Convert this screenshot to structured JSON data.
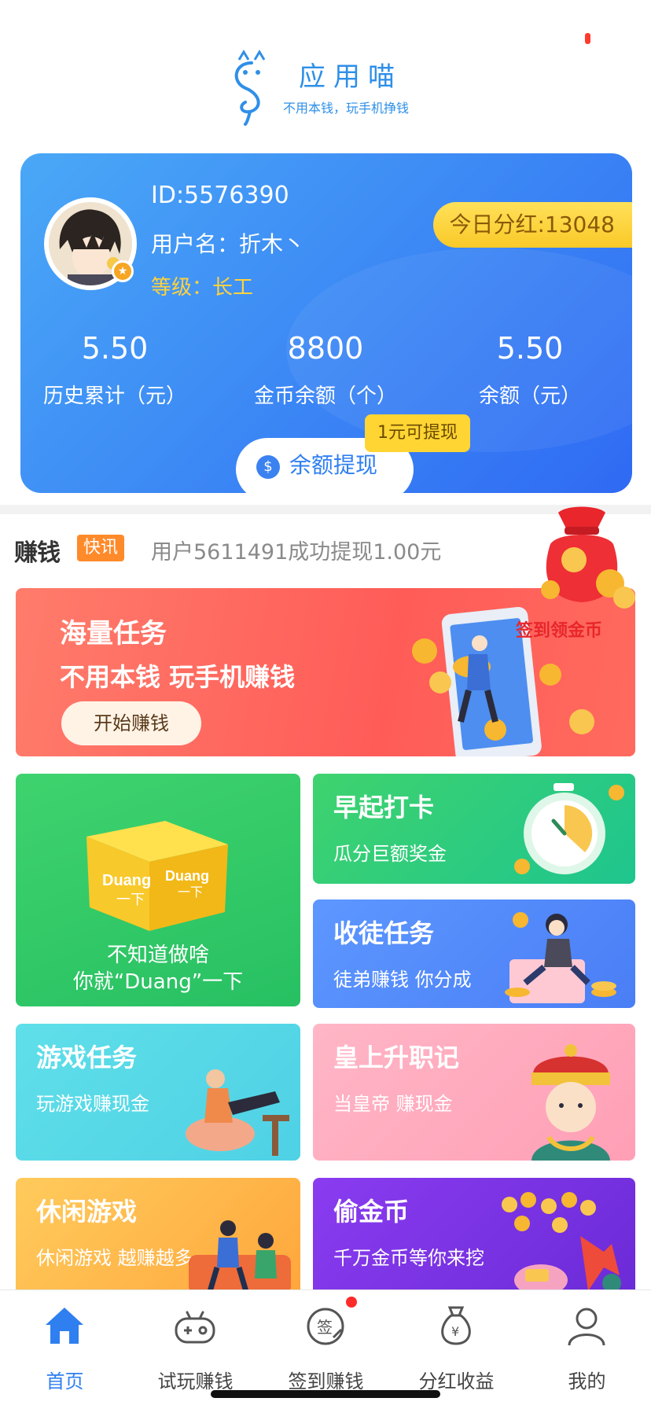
{
  "header": {
    "app_name": "应用喵",
    "slogan": "不用本钱，玩手机挣钱"
  },
  "user": {
    "id_text": "ID:5576390",
    "name_text": "用户名：折木丶",
    "level_text": "等级：长工",
    "dividend_text": "今日分红:13048",
    "stats": [
      {
        "value": "5.50",
        "label": "历史累计（元）"
      },
      {
        "value": "8800",
        "label": "金币余额（个）"
      },
      {
        "value": "5.50",
        "label": "余额（元）"
      }
    ],
    "withdraw_label": "余额提现",
    "withdraw_tip": "1元可提现"
  },
  "news": {
    "brand": "赚钱",
    "tag": "快讯",
    "text": "用户5611491成功提现1.00元"
  },
  "checkin_float": {
    "label": "签到领金币"
  },
  "banner": {
    "title": "海量任务",
    "subtitle": "不用本钱 玩手机赚钱",
    "button": "开始赚钱"
  },
  "tiles": {
    "duang": {
      "line1": "不知道做啥",
      "line2": "你就“Duang”一下",
      "box_text_1": "Duang",
      "box_text_2": "一下"
    },
    "morning": {
      "title": "早起打卡",
      "subtitle": "瓜分巨额奖金"
    },
    "disciple": {
      "title": "收徒任务",
      "subtitle": "徒弟赚钱 你分成"
    },
    "game": {
      "title": "游戏任务",
      "subtitle": "玩游戏赚现金"
    },
    "emperor": {
      "title": "皇上升职记",
      "subtitle": "当皇帝 赚现金"
    },
    "casual": {
      "title": "休闲游戏",
      "subtitle": "休闲游戏 越赚越多"
    },
    "steal": {
      "title": "偷金币",
      "subtitle": "千万金币等你来挖"
    }
  },
  "nav": {
    "items": [
      {
        "label": "首页",
        "icon": "home-icon",
        "active": true
      },
      {
        "label": "试玩赚钱",
        "icon": "gamepad-icon"
      },
      {
        "label": "签到赚钱",
        "icon": "sign-in-icon",
        "icon_text": "签"
      },
      {
        "label": "分红收益",
        "icon": "money-bag-icon",
        "icon_text": "¥"
      },
      {
        "label": "我的",
        "icon": "user-icon"
      }
    ]
  },
  "colors": {
    "brand_blue": "#2f7ff0",
    "accent_yellow": "#ffd533",
    "accent_red": "#ff5c58"
  }
}
